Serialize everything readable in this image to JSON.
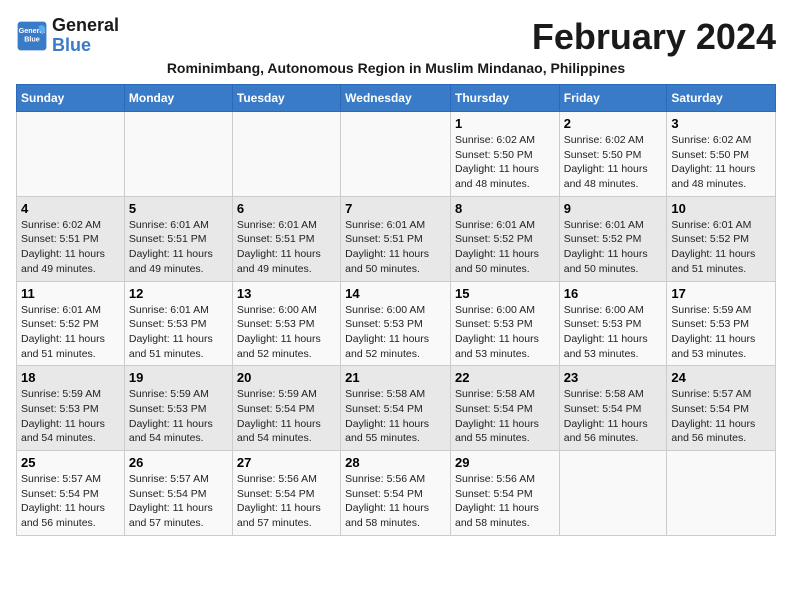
{
  "header": {
    "logo_line1": "General",
    "logo_line2": "Blue",
    "title": "February 2024",
    "subtitle": "Rominimbang, Autonomous Region in Muslim Mindanao, Philippines"
  },
  "calendar": {
    "days_of_week": [
      "Sunday",
      "Monday",
      "Tuesday",
      "Wednesday",
      "Thursday",
      "Friday",
      "Saturday"
    ],
    "weeks": [
      [
        {
          "day": "",
          "info": ""
        },
        {
          "day": "",
          "info": ""
        },
        {
          "day": "",
          "info": ""
        },
        {
          "day": "",
          "info": ""
        },
        {
          "day": "1",
          "info": "Sunrise: 6:02 AM\nSunset: 5:50 PM\nDaylight: 11 hours and 48 minutes."
        },
        {
          "day": "2",
          "info": "Sunrise: 6:02 AM\nSunset: 5:50 PM\nDaylight: 11 hours and 48 minutes."
        },
        {
          "day": "3",
          "info": "Sunrise: 6:02 AM\nSunset: 5:50 PM\nDaylight: 11 hours and 48 minutes."
        }
      ],
      [
        {
          "day": "4",
          "info": "Sunrise: 6:02 AM\nSunset: 5:51 PM\nDaylight: 11 hours and 49 minutes."
        },
        {
          "day": "5",
          "info": "Sunrise: 6:01 AM\nSunset: 5:51 PM\nDaylight: 11 hours and 49 minutes."
        },
        {
          "day": "6",
          "info": "Sunrise: 6:01 AM\nSunset: 5:51 PM\nDaylight: 11 hours and 49 minutes."
        },
        {
          "day": "7",
          "info": "Sunrise: 6:01 AM\nSunset: 5:51 PM\nDaylight: 11 hours and 50 minutes."
        },
        {
          "day": "8",
          "info": "Sunrise: 6:01 AM\nSunset: 5:52 PM\nDaylight: 11 hours and 50 minutes."
        },
        {
          "day": "9",
          "info": "Sunrise: 6:01 AM\nSunset: 5:52 PM\nDaylight: 11 hours and 50 minutes."
        },
        {
          "day": "10",
          "info": "Sunrise: 6:01 AM\nSunset: 5:52 PM\nDaylight: 11 hours and 51 minutes."
        }
      ],
      [
        {
          "day": "11",
          "info": "Sunrise: 6:01 AM\nSunset: 5:52 PM\nDaylight: 11 hours and 51 minutes."
        },
        {
          "day": "12",
          "info": "Sunrise: 6:01 AM\nSunset: 5:53 PM\nDaylight: 11 hours and 51 minutes."
        },
        {
          "day": "13",
          "info": "Sunrise: 6:00 AM\nSunset: 5:53 PM\nDaylight: 11 hours and 52 minutes."
        },
        {
          "day": "14",
          "info": "Sunrise: 6:00 AM\nSunset: 5:53 PM\nDaylight: 11 hours and 52 minutes."
        },
        {
          "day": "15",
          "info": "Sunrise: 6:00 AM\nSunset: 5:53 PM\nDaylight: 11 hours and 53 minutes."
        },
        {
          "day": "16",
          "info": "Sunrise: 6:00 AM\nSunset: 5:53 PM\nDaylight: 11 hours and 53 minutes."
        },
        {
          "day": "17",
          "info": "Sunrise: 5:59 AM\nSunset: 5:53 PM\nDaylight: 11 hours and 53 minutes."
        }
      ],
      [
        {
          "day": "18",
          "info": "Sunrise: 5:59 AM\nSunset: 5:53 PM\nDaylight: 11 hours and 54 minutes."
        },
        {
          "day": "19",
          "info": "Sunrise: 5:59 AM\nSunset: 5:53 PM\nDaylight: 11 hours and 54 minutes."
        },
        {
          "day": "20",
          "info": "Sunrise: 5:59 AM\nSunset: 5:54 PM\nDaylight: 11 hours and 54 minutes."
        },
        {
          "day": "21",
          "info": "Sunrise: 5:58 AM\nSunset: 5:54 PM\nDaylight: 11 hours and 55 minutes."
        },
        {
          "day": "22",
          "info": "Sunrise: 5:58 AM\nSunset: 5:54 PM\nDaylight: 11 hours and 55 minutes."
        },
        {
          "day": "23",
          "info": "Sunrise: 5:58 AM\nSunset: 5:54 PM\nDaylight: 11 hours and 56 minutes."
        },
        {
          "day": "24",
          "info": "Sunrise: 5:57 AM\nSunset: 5:54 PM\nDaylight: 11 hours and 56 minutes."
        }
      ],
      [
        {
          "day": "25",
          "info": "Sunrise: 5:57 AM\nSunset: 5:54 PM\nDaylight: 11 hours and 56 minutes."
        },
        {
          "day": "26",
          "info": "Sunrise: 5:57 AM\nSunset: 5:54 PM\nDaylight: 11 hours and 57 minutes."
        },
        {
          "day": "27",
          "info": "Sunrise: 5:56 AM\nSunset: 5:54 PM\nDaylight: 11 hours and 57 minutes."
        },
        {
          "day": "28",
          "info": "Sunrise: 5:56 AM\nSunset: 5:54 PM\nDaylight: 11 hours and 58 minutes."
        },
        {
          "day": "29",
          "info": "Sunrise: 5:56 AM\nSunset: 5:54 PM\nDaylight: 11 hours and 58 minutes."
        },
        {
          "day": "",
          "info": ""
        },
        {
          "day": "",
          "info": ""
        }
      ]
    ]
  }
}
